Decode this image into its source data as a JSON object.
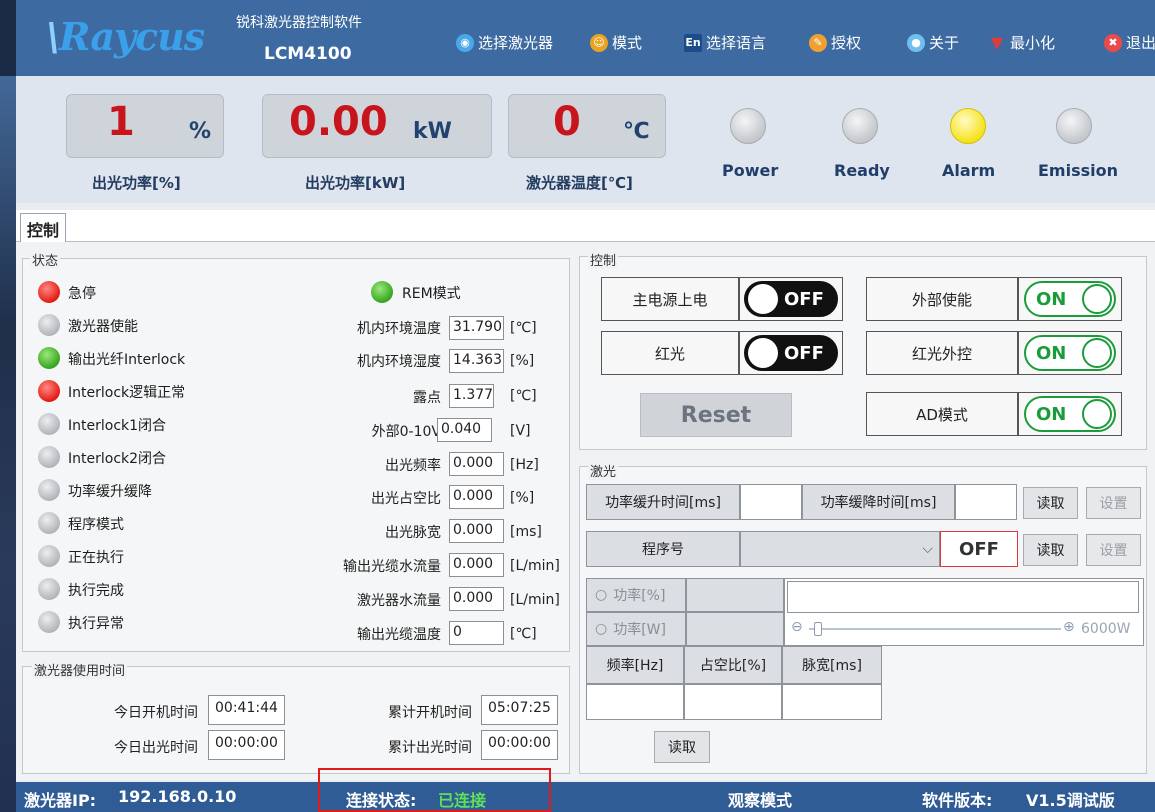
{
  "app": {
    "logo": "Raycus",
    "subtitle": "锐科激光器控制软件",
    "model": "LCM4100"
  },
  "toolbar": [
    {
      "label": "选择激光器",
      "icon": "globe-icon",
      "color": "#4aa8e8"
    },
    {
      "label": "模式",
      "icon": "users-icon",
      "color": "#e8a323"
    },
    {
      "label": "选择语言",
      "icon": "en-language-icon",
      "color": "#1d4c8c"
    },
    {
      "label": "授权",
      "icon": "key-icon",
      "color": "#f0a030"
    },
    {
      "label": "关于",
      "icon": "info-icon",
      "color": "#6fc0f0"
    },
    {
      "label": "最小化",
      "icon": "minimize-icon",
      "color": "#e23b3b"
    },
    {
      "label": "退出",
      "icon": "close-icon",
      "color": "#e94a4a"
    }
  ],
  "gauges": [
    {
      "value": "1",
      "unit": "%",
      "label": "出光功率[%]"
    },
    {
      "value": "0.00",
      "unit": "kW",
      "label": "出光功率[kW]"
    },
    {
      "value": "0",
      "unit": "℃",
      "label": "激光器温度[℃]"
    }
  ],
  "indicators": [
    {
      "label": "Power",
      "state": "gray"
    },
    {
      "label": "Ready",
      "state": "gray"
    },
    {
      "label": "Alarm",
      "state": "yellow"
    },
    {
      "label": "Emission",
      "state": "gray"
    }
  ],
  "tab": "控制",
  "status": {
    "title": "状态",
    "items": [
      {
        "label": "急停",
        "state": "red"
      },
      {
        "label": "激光器使能",
        "state": "gray"
      },
      {
        "label": "输出光纤Interlock",
        "state": "green"
      },
      {
        "label": "Interlock逻辑正常",
        "state": "red"
      },
      {
        "label": "Interlock1闭合",
        "state": "gray"
      },
      {
        "label": "Interlock2闭合",
        "state": "gray"
      },
      {
        "label": "功率缓升缓降",
        "state": "gray"
      },
      {
        "label": "程序模式",
        "state": "gray"
      },
      {
        "label": "正在执行",
        "state": "gray"
      },
      {
        "label": "执行完成",
        "state": "gray"
      },
      {
        "label": "执行异常",
        "state": "gray"
      }
    ],
    "rem": {
      "label": "REM模式",
      "state": "green"
    },
    "params": [
      {
        "label": "机内环境温度",
        "value": "31.790",
        "unit": "[℃]"
      },
      {
        "label": "机内环境湿度",
        "value": "14.363",
        "unit": "[%]"
      },
      {
        "label": "露点",
        "value": "1.377",
        "unit": "[℃]"
      },
      {
        "label": "外部0-10V",
        "value": "0.040",
        "unit": "[V]"
      },
      {
        "label": "出光频率",
        "value": "0.000",
        "unit": "[Hz]"
      },
      {
        "label": "出光占空比",
        "value": "0.000",
        "unit": "[%]"
      },
      {
        "label": "出光脉宽",
        "value": "0.000",
        "unit": "[ms]"
      },
      {
        "label": "输出光缆水流量",
        "value": "0.000",
        "unit": "[L/min]"
      },
      {
        "label": "激光器水流量",
        "value": "0.000",
        "unit": "[L/min]"
      },
      {
        "label": "输出光缆温度",
        "value": "0",
        "unit": "[℃]"
      }
    ]
  },
  "usage": {
    "title": "激光器使用时间",
    "today_on_label": "今日开机时间",
    "today_on": "00:41:44",
    "total_on_label": "累计开机时间",
    "total_on": "05:07:25",
    "today_emit_label": "今日出光时间",
    "today_emit": "00:00:00",
    "total_emit_label": "累计出光时间",
    "total_emit": "00:00:00"
  },
  "control": {
    "title": "控制",
    "main_power": {
      "label": "主电源上电",
      "toggle": "OFF"
    },
    "red_light": {
      "label": "红光",
      "toggle": "OFF"
    },
    "external_enable": {
      "label": "外部使能",
      "toggle": "ON"
    },
    "red_external": {
      "label": "红光外控",
      "toggle": "ON"
    },
    "ad_mode": {
      "label": "AD模式",
      "toggle": "ON"
    },
    "reset": "Reset"
  },
  "laser": {
    "title": "激光",
    "ramp_up_label": "功率缓升时间[ms]",
    "ramp_up_value": "",
    "ramp_down_label": "功率缓降时间[ms]",
    "ramp_down_value": "",
    "read": "读取",
    "set": "设置",
    "program_label": "程序号",
    "program_value": "",
    "program_state": "OFF",
    "power_pct": "功率[%]",
    "power_w": "功率[W]",
    "power_pct_value": "",
    "power_w_value": "",
    "slider_max": "6000W",
    "slider_level": 0.02,
    "freq": "频率[Hz]",
    "duty": "占空比[%]",
    "pulse": "脉宽[ms]",
    "freq_value": "",
    "duty_value": "",
    "pulse_value": "",
    "read2": "读取"
  },
  "statusbar": {
    "ip_label": "激光器IP:",
    "ip": "192.168.0.10",
    "conn_label": "连接状态:",
    "conn": "已连接",
    "mode": "观察模式",
    "ver_label": "软件版本:",
    "ver": "V1.5调试版"
  }
}
